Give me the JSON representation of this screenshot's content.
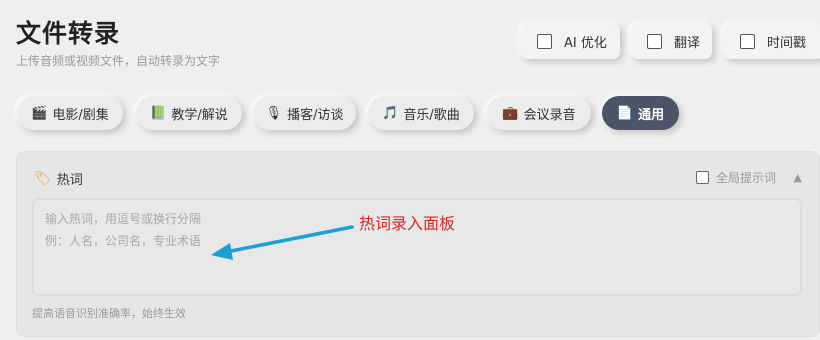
{
  "header": {
    "title": "文件转录",
    "subtitle": "上传音频或视频文件，自动转录为文字"
  },
  "options": {
    "ai_optimize": "AI 优化",
    "translate": "翻译",
    "timestamp": "时间戳"
  },
  "categories": [
    {
      "icon": "🎬",
      "label": "电影/剧集",
      "active": false
    },
    {
      "icon": "📗",
      "label": "教学/解说",
      "active": false
    },
    {
      "icon": "🎙",
      "label": "播客/访谈",
      "active": false
    },
    {
      "icon": "🎵",
      "label": "音乐/歌曲",
      "active": false
    },
    {
      "icon": "💼",
      "label": "会议录音",
      "active": false
    },
    {
      "icon": "📄",
      "label": "通用",
      "active": true
    }
  ],
  "hotwords": {
    "icon": "🏷",
    "title": "热词",
    "global_label": "全局提示词",
    "collapse_glyph": "▲",
    "placeholder": "输入热词，用逗号或换行分隔\n例：人名，公司名，专业术语",
    "footnote": "提高语音识别准确率，始终生效"
  },
  "annotation": {
    "text": "热词录入面板",
    "color": "#e02424",
    "arrow_color": "#1a9fd8"
  },
  "colors": {
    "active_chip": "#4a5568",
    "background": "#efefef"
  }
}
